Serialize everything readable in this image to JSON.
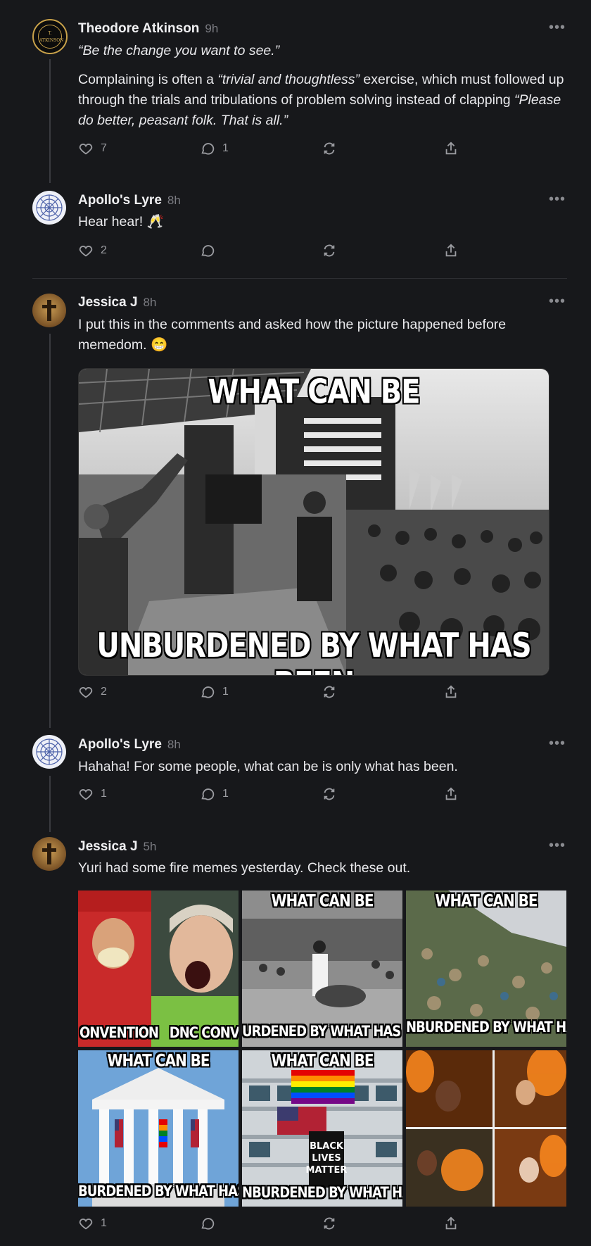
{
  "posts": [
    {
      "author": "Theodore Atkinson",
      "time": "9h",
      "avatar_text": "T. ATKINSON",
      "quote": "“Be the change you want to see.”",
      "body_parts": [
        "Complaining is often a ",
        "“trivial and thoughtless”",
        " exercise, which must followed up through the trials and tribulations of problem solving instead of clapping ",
        "“Please do better, peasant folk. That is all.”"
      ],
      "likes": "7",
      "replies": "1"
    },
    {
      "author": "Apollo's Lyre",
      "time": "8h",
      "body": "Hear hear! 🥂",
      "likes": "2",
      "replies": ""
    },
    {
      "author": "Jessica J",
      "time": "8h",
      "body": "I put this in the comments and asked how the picture happened before memedom. 😁",
      "meme_top": "WHAT CAN BE",
      "meme_bottom": "UNBURDENED BY WHAT HAS BEEN",
      "likes": "2",
      "replies": "1"
    },
    {
      "author": "Apollo's Lyre",
      "time": "8h",
      "body": "Hahaha! For some people, what can be is only what has been.",
      "likes": "1",
      "replies": "1"
    },
    {
      "author": "Jessica J",
      "time": "5h",
      "body": "Yuri had some fire memes yesterday. Check these out.",
      "likes": "1",
      "replies": "",
      "grid": [
        {
          "top": "",
          "bottom": "ONVENTION   DNC CONVENT"
        },
        {
          "top": "WHAT CAN BE",
          "bottom": "URDENED BY WHAT HAS BEI"
        },
        {
          "top": "WHAT CAN BE",
          "bottom": "NBURDENED BY WHAT HAS I"
        },
        {
          "top": "WHAT CAN BE",
          "bottom": "BURDENED BY WHAT HAS"
        },
        {
          "top": "WHAT CAN BE",
          "bottom": "NBURDENED BY WHAT HAS"
        },
        {
          "top": "",
          "bottom": ""
        }
      ]
    }
  ],
  "icons": [
    "heart-icon",
    "comment-icon",
    "repost-icon",
    "share-icon",
    "more-icon"
  ],
  "colors": {
    "background": "#17181b",
    "text": "#e7e7e9",
    "muted": "#7b7c82"
  }
}
